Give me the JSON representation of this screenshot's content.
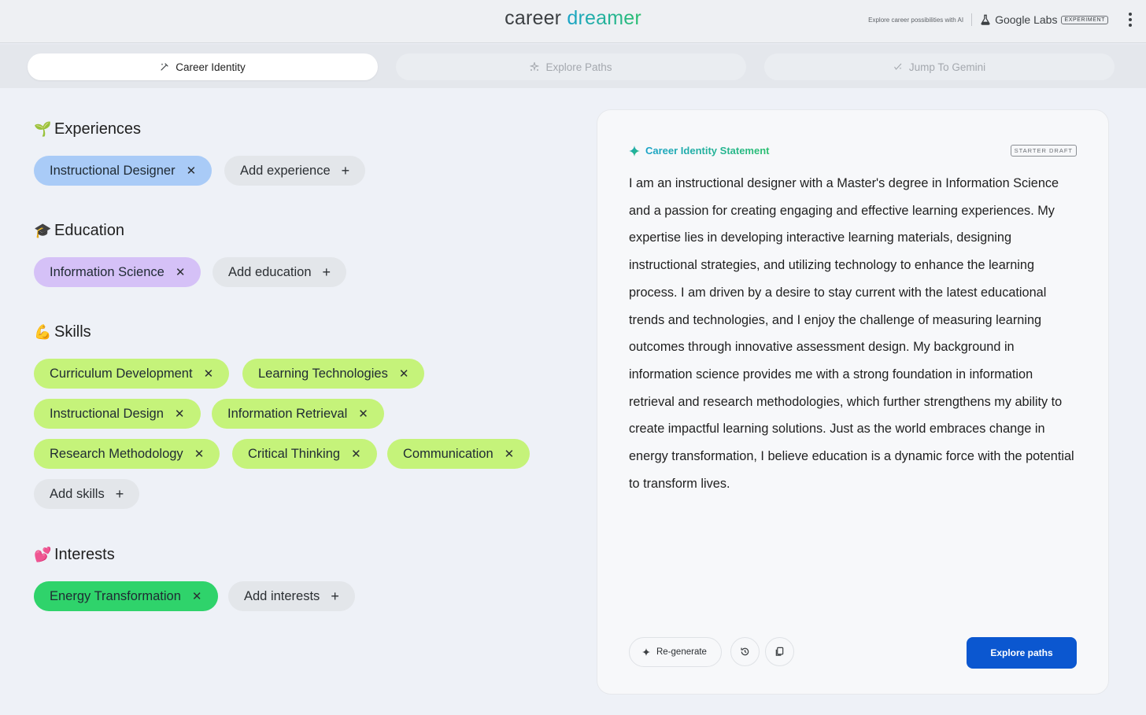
{
  "header": {
    "logo_word1": "career",
    "logo_word2": "dreamer",
    "tagline": "Explore career possibilities with AI",
    "labs_label": "Google Labs",
    "experiment_badge": "EXPERIMENT"
  },
  "tabs": [
    {
      "label": "Career Identity",
      "active": true,
      "icon": "pencil-sparkle-icon"
    },
    {
      "label": "Explore Paths",
      "active": false,
      "icon": "sparkle-cluster-icon"
    },
    {
      "label": "Jump To Gemini",
      "active": false,
      "icon": "gemini-sparkle-icon"
    }
  ],
  "experiences": {
    "title": "Experiences",
    "items": [
      "Instructional Designer"
    ],
    "add_label": "Add experience"
  },
  "education": {
    "title": "Education",
    "items": [
      "Information Science"
    ],
    "add_label": "Add education"
  },
  "skills": {
    "title": "Skills",
    "items": [
      "Curriculum Development",
      "Learning Technologies",
      "Instructional Design",
      "Information Retrieval",
      "Research Methodology",
      "Critical Thinking",
      "Communication"
    ],
    "add_label": "Add skills"
  },
  "interests": {
    "title": "Interests",
    "items": [
      "Energy Transformation"
    ],
    "add_label": "Add interests"
  },
  "card": {
    "title": "Career Identity Statement",
    "badge": "STARTER DRAFT",
    "statement": "I am an instructional designer with a Master's degree in Information Science and a passion for creating engaging and effective learning experiences. My expertise lies in developing interactive learning materials, designing instructional strategies, and utilizing technology to enhance the learning process. I am driven by a desire to stay current with the latest educational trends and technologies, and I enjoy the challenge of measuring learning outcomes through innovative assessment design. My background in information science provides me with a strong foundation in information retrieval and research methodologies, which further strengthens my ability to create impactful learning solutions. Just as the world embraces change in energy transformation, I believe education is a dynamic force with the potential to transform lives.",
    "regenerate_label": "Re-generate",
    "explore_button": "Explore paths"
  },
  "colors": {
    "experience_chip": "#a9cbf7",
    "education_chip": "#d5c1f7",
    "skill_chip": "#c5f37a",
    "interest_chip": "#2fd36b",
    "primary_button": "#0b57d0"
  }
}
